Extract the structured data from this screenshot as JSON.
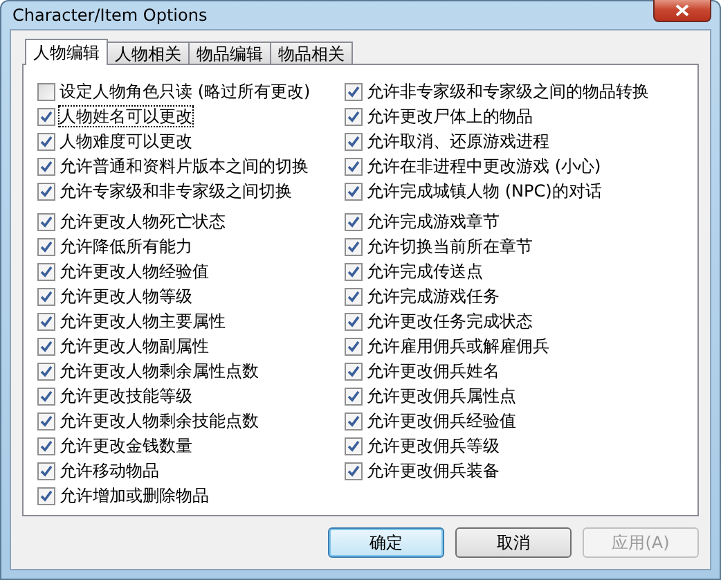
{
  "window": {
    "title": "Character/Item Options"
  },
  "tabs": [
    {
      "label": "人物编辑",
      "selected": true
    },
    {
      "label": "人物相关",
      "selected": false
    },
    {
      "label": "物品编辑",
      "selected": false
    },
    {
      "label": "物品相关",
      "selected": false
    }
  ],
  "columns": [
    {
      "groups": [
        [
          {
            "label": "设定人物角色只读 (略过所有更改)",
            "checked": false,
            "focused": false
          },
          {
            "label": "人物姓名可以更改",
            "checked": true,
            "focused": true
          },
          {
            "label": "人物难度可以更改",
            "checked": true,
            "focused": false
          },
          {
            "label": "允许普通和资料片版本之间的切换",
            "checked": true,
            "focused": false
          },
          {
            "label": "允许专家级和非专家级之间切换",
            "checked": true,
            "focused": false
          }
        ],
        [
          {
            "label": "允许更改人物死亡状态",
            "checked": true,
            "focused": false
          },
          {
            "label": "允许降低所有能力",
            "checked": true,
            "focused": false
          },
          {
            "label": "允许更改人物经验值",
            "checked": true,
            "focused": false
          },
          {
            "label": "允许更改人物等级",
            "checked": true,
            "focused": false
          },
          {
            "label": "允许更改人物主要属性",
            "checked": true,
            "focused": false
          },
          {
            "label": "允许更改人物副属性",
            "checked": true,
            "focused": false
          },
          {
            "label": "允许更改人物剩余属性点数",
            "checked": true,
            "focused": false
          },
          {
            "label": "允许更改技能等级",
            "checked": true,
            "focused": false
          },
          {
            "label": "允许更改人物剩余技能点数",
            "checked": true,
            "focused": false
          },
          {
            "label": "允许更改金钱数量",
            "checked": true,
            "focused": false
          },
          {
            "label": "允许移动物品",
            "checked": true,
            "focused": false
          },
          {
            "label": "允许增加或删除物品",
            "checked": true,
            "focused": false
          }
        ]
      ]
    },
    {
      "groups": [
        [
          {
            "label": "允许非专家级和专家级之间的物品转换",
            "checked": true,
            "focused": false
          },
          {
            "label": "允许更改尸体上的物品",
            "checked": true,
            "focused": false
          },
          {
            "label": "允许取消、还原游戏进程",
            "checked": true,
            "focused": false
          },
          {
            "label": "允许在非进程中更改游戏 (小心)",
            "checked": true,
            "focused": false
          },
          {
            "label": "允许完成城镇人物 (NPC)的对话",
            "checked": true,
            "focused": false
          }
        ],
        [
          {
            "label": "允许完成游戏章节",
            "checked": true,
            "focused": false
          },
          {
            "label": "允许切换当前所在章节",
            "checked": true,
            "focused": false
          },
          {
            "label": "允许完成传送点",
            "checked": true,
            "focused": false
          },
          {
            "label": "允许完成游戏任务",
            "checked": true,
            "focused": false
          },
          {
            "label": "允许更改任务完成状态",
            "checked": true,
            "focused": false
          },
          {
            "label": "允许雇用佣兵或解雇佣兵",
            "checked": true,
            "focused": false
          },
          {
            "label": "允许更改佣兵姓名",
            "checked": true,
            "focused": false
          },
          {
            "label": "允许更改佣兵属性点",
            "checked": true,
            "focused": false
          },
          {
            "label": "允许更改佣兵经验值",
            "checked": true,
            "focused": false
          },
          {
            "label": "允许更改佣兵等级",
            "checked": true,
            "focused": false
          },
          {
            "label": "允许更改佣兵装备",
            "checked": true,
            "focused": false
          }
        ]
      ]
    }
  ],
  "buttons": [
    {
      "label": "确定",
      "default": true,
      "disabled": false
    },
    {
      "label": "取消",
      "default": false,
      "disabled": false
    },
    {
      "label": "应用(A)",
      "default": false,
      "disabled": true
    }
  ]
}
